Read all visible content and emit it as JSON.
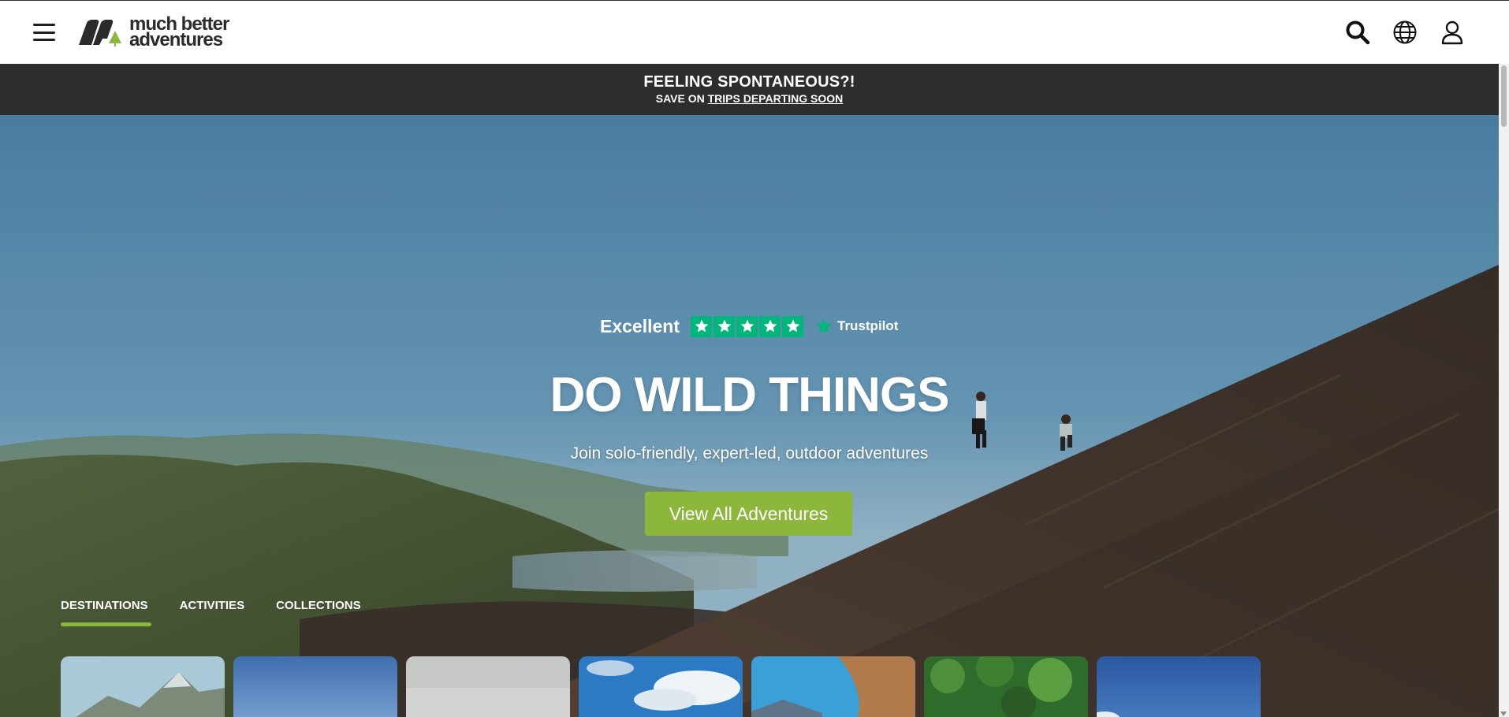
{
  "header": {
    "menu_icon": "hamburger-menu-icon",
    "logo_line1": "much better",
    "logo_line2": "adventures",
    "icons": [
      "search-icon",
      "globe-icon",
      "user-icon"
    ]
  },
  "announcement": {
    "title": "FEELING SPONTANEOUS?!",
    "sub_prefix": "SAVE ON ",
    "sub_link": "TRIPS DEPARTING SOON"
  },
  "hero": {
    "rating_label": "Excellent",
    "rating_stars": 5,
    "review_brand": "Trustpilot",
    "title": "DO WILD THINGS",
    "subtitle": "Join solo-friendly, expert-led, outdoor adventures",
    "cta_label": "View All Adventures"
  },
  "tabs": [
    {
      "label": "DESTINATIONS",
      "active": true
    },
    {
      "label": "ACTIVITIES",
      "active": false
    },
    {
      "label": "COLLECTIONS",
      "active": false
    }
  ],
  "colors": {
    "brand_green": "#8cb63c",
    "announce_bg": "#2c2e2d",
    "trustpilot_green": "#00b67a"
  }
}
